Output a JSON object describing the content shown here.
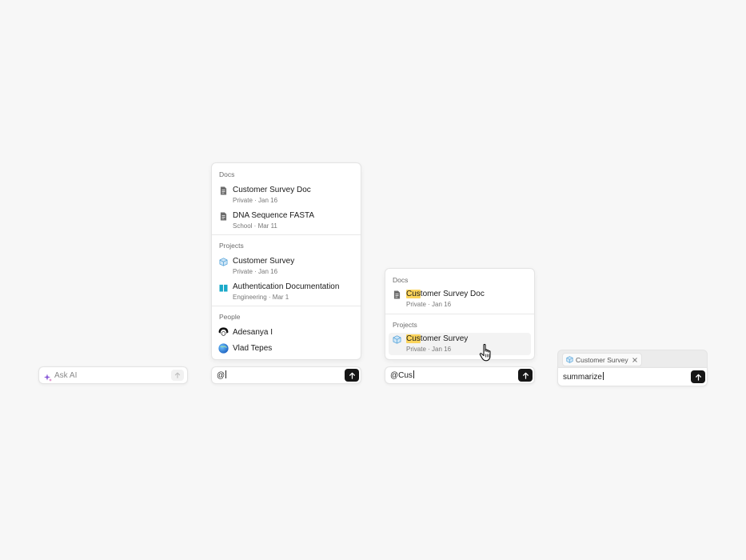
{
  "panel1": {
    "ask_ai_placeholder": "Ask AI"
  },
  "panel2": {
    "sections": {
      "docs": "Docs",
      "projects": "Projects",
      "people": "People"
    },
    "docs": [
      {
        "title": "Customer Survey Doc",
        "meta": "Private · Jan 16"
      },
      {
        "title": "DNA Sequence FASTA",
        "meta": "School · Mar 11"
      }
    ],
    "projects": [
      {
        "title": "Customer Survey",
        "meta": "Private · Jan 16"
      },
      {
        "title": "Authentication Documentation",
        "meta": "Engineering · Mar 1"
      }
    ],
    "people": [
      {
        "name": "Adesanya I"
      },
      {
        "name": "Vlad Tepes"
      }
    ],
    "input_value": "@"
  },
  "panel3": {
    "sections": {
      "docs": "Docs",
      "projects": "Projects"
    },
    "doc": {
      "match": "Cus",
      "rest": "tomer Survey Doc",
      "meta": "Private · Jan 16"
    },
    "project": {
      "match": "Cus",
      "rest": "tomer Survey",
      "meta": "Private · Jan 16"
    },
    "input_value": "@Cus"
  },
  "panel4": {
    "chip_label": "Customer Survey",
    "input_value": "summarize"
  },
  "icons": {
    "sparkle": "sparkle-icon",
    "doc": "document-icon",
    "project": "cube-icon",
    "book": "book-icon",
    "send": "arrow-up-icon",
    "close": "close-icon",
    "cursor": "hand-pointer-icon"
  },
  "colors": {
    "highlight": "#fbd45c",
    "send_button": "#161616",
    "book": "#1aa9c9",
    "cube": "#4d9fd8"
  }
}
